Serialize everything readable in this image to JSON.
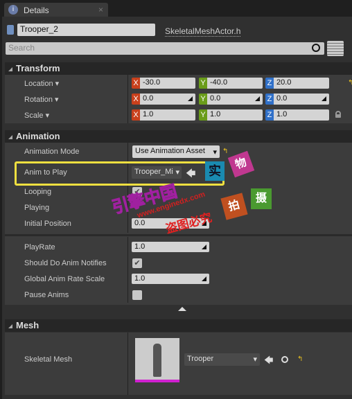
{
  "tab": {
    "title": "Details",
    "icon": "info-icon",
    "close": "×"
  },
  "actor": {
    "name": "Trooper_2",
    "class_link": "SkeletalMeshActor.h"
  },
  "search": {
    "placeholder": "Search"
  },
  "transform": {
    "title": "Transform",
    "location": {
      "label": "Location",
      "x": "-30.0",
      "y": "-40.0",
      "z": "20.0"
    },
    "rotation": {
      "label": "Rotation",
      "x": "0.0",
      "y": "0.0",
      "z": "0.0"
    },
    "scale": {
      "label": "Scale",
      "x": "1.0",
      "y": "1.0",
      "z": "1.0"
    },
    "axes": {
      "x": "X",
      "y": "Y",
      "z": "Z"
    }
  },
  "animation": {
    "title": "Animation",
    "mode": {
      "label": "Animation Mode",
      "value": "Use Animation Asset"
    },
    "anim_to_play": {
      "label": "Anim to Play",
      "value": "Trooper_Mi"
    },
    "looping": {
      "label": "Looping",
      "checked": true
    },
    "playing": {
      "label": "Playing",
      "checked": false
    },
    "initial_position": {
      "label": "Initial Position",
      "value": "0.0"
    },
    "play_rate": {
      "label": "PlayRate",
      "value": "1.0"
    },
    "notifies": {
      "label": "Should Do Anim Notifies",
      "checked": true
    },
    "global_rate": {
      "label": "Global Anim Rate Scale",
      "value": "1.0"
    },
    "pause": {
      "label": "Pause Anims",
      "checked": false
    }
  },
  "mesh": {
    "title": "Mesh",
    "skeletal_mesh": {
      "label": "Skeletal Mesh",
      "value": "Trooper"
    }
  },
  "watermark": {
    "a": "实",
    "b": "物",
    "c": "拍",
    "d": "摄",
    "site": "引擎中国",
    "url": "www.enginedx.com",
    "warn": "盗图必究"
  },
  "colors": {
    "x": "#c8401c",
    "y": "#6a9c1a",
    "z": "#3070c8",
    "highlight": "#f0e040",
    "reset": "#e8c020"
  }
}
